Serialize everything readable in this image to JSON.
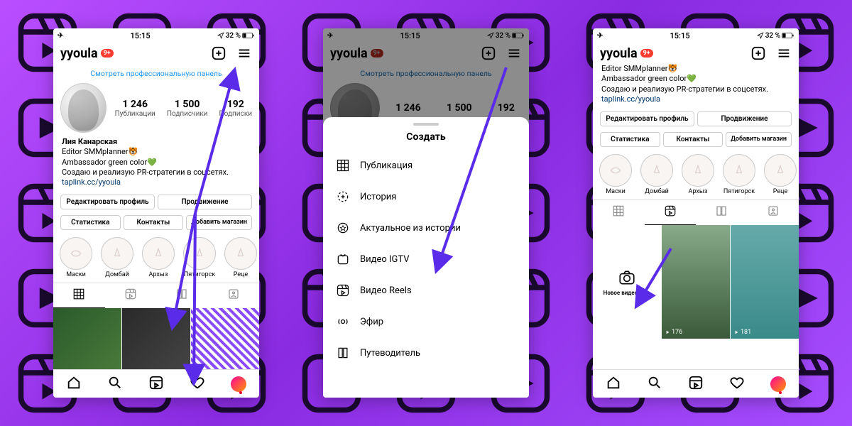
{
  "status": {
    "time": "15:15",
    "battery_pct": "32 %",
    "airplane": true
  },
  "header": {
    "username": "yyoula",
    "badge": "9+"
  },
  "dashboard_link": "Смотреть профессиональную панель",
  "stats": [
    {
      "num": "1 246",
      "lbl": "Публикации"
    },
    {
      "num": "1 500",
      "lbl": "Подписчики"
    },
    {
      "num": "192",
      "lbl": "Подписки"
    }
  ],
  "bio": {
    "name": "Лия Канарская",
    "line1": "Editor SMMplanner🐯",
    "line2": "Ambassador green color💚",
    "line3": "Создаю и реализую PR-стратегии в соцсетях.",
    "link": "taplink.cc/yyoula"
  },
  "buttons": {
    "edit": "Редактировать профиль",
    "promo": "Продвижение",
    "stats": "Статистика",
    "contacts": "Контакты",
    "addshop": "Добавить магазин"
  },
  "highlights": [
    {
      "name": "Маски"
    },
    {
      "name": "Домбай"
    },
    {
      "name": "Архыз"
    },
    {
      "name": "Пятигорск"
    },
    {
      "name": "Реце"
    }
  ],
  "create_sheet": {
    "title": "Создать",
    "items": [
      "Публикация",
      "История",
      "Актуальное из истории",
      "Видео IGTV",
      "Видео Reels",
      "Эфир",
      "Путеводитель"
    ]
  },
  "screen3": {
    "new_reel_label": "Новое видео Re...",
    "views1": "176",
    "views2": "181"
  }
}
